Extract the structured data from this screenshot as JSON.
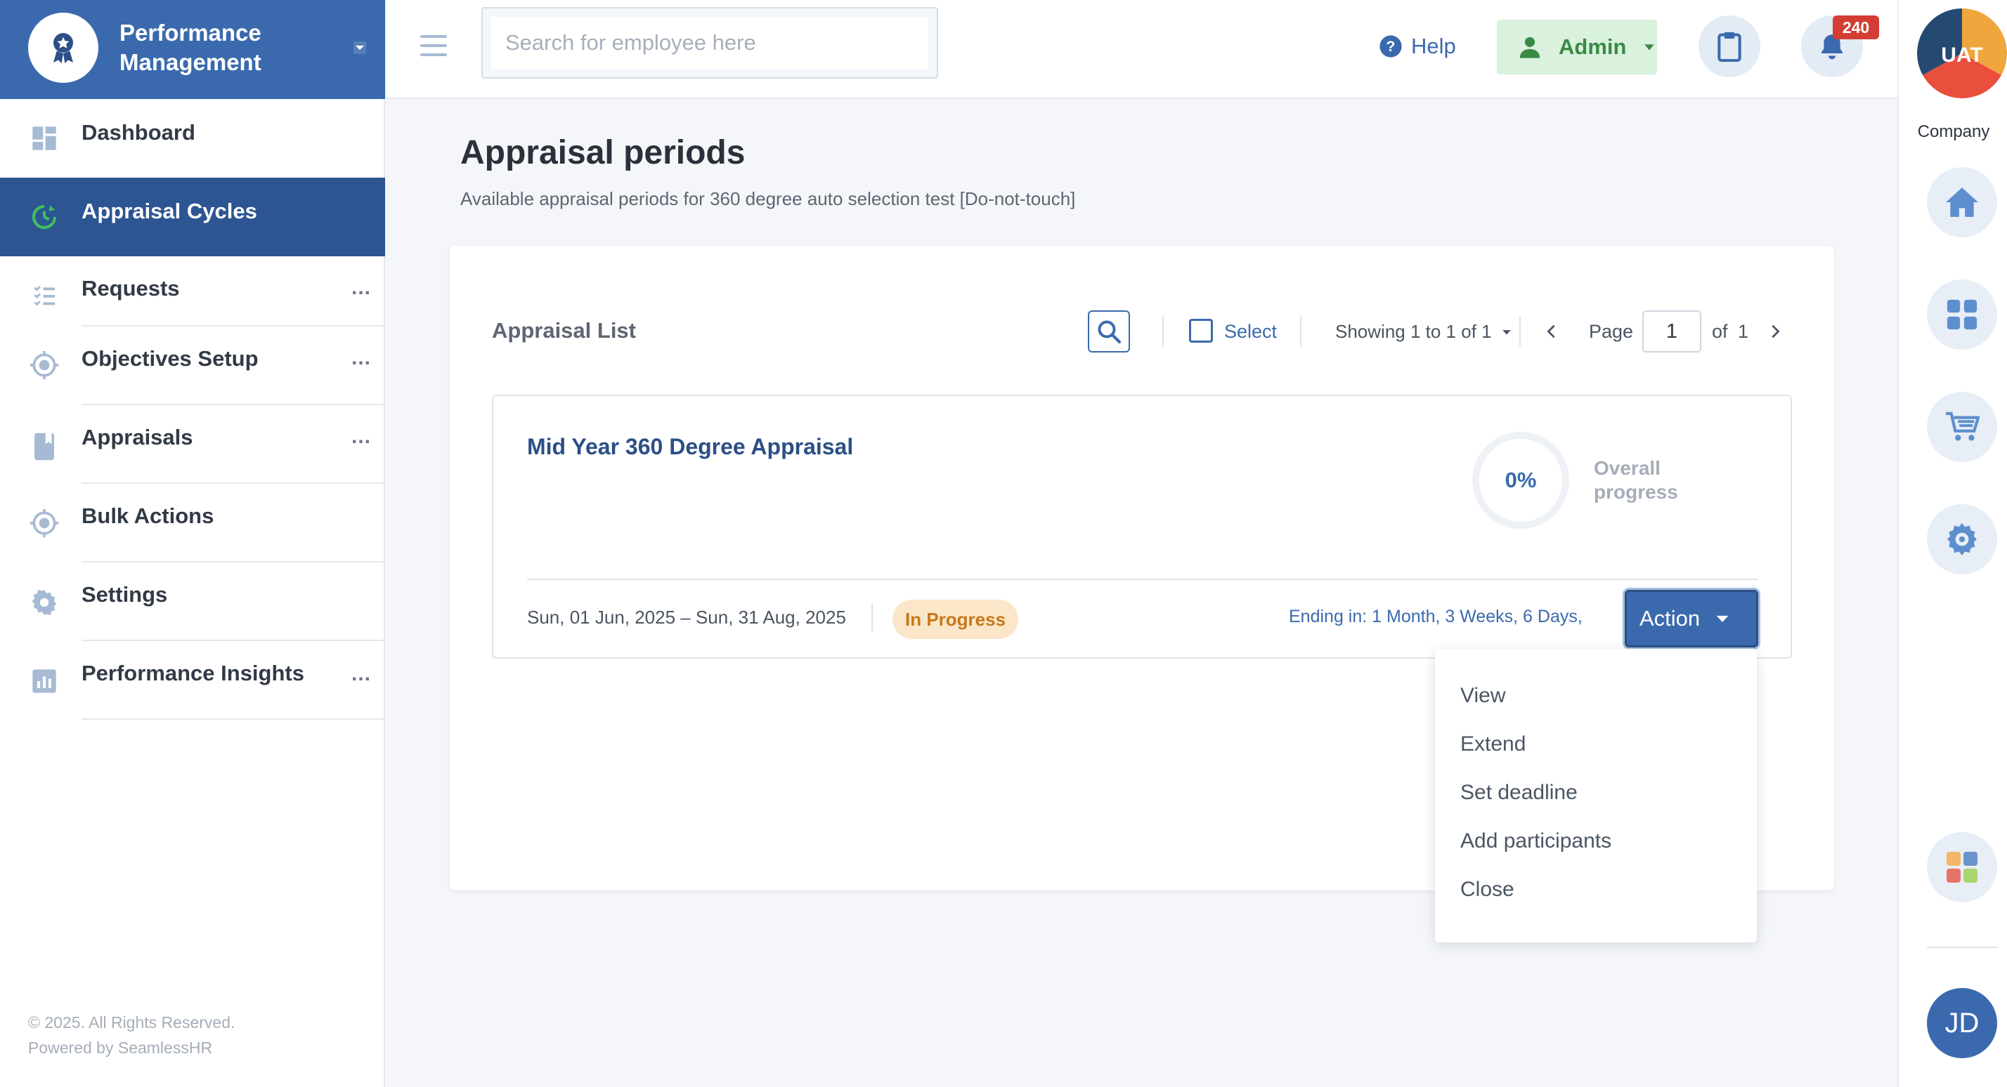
{
  "sidebar": {
    "brand_title": "Performance Management",
    "items": [
      {
        "label": "Dashboard",
        "icon": "dashboard-icon",
        "more": ""
      },
      {
        "label": "Appraisal Cycles",
        "icon": "cycle-icon",
        "more": ""
      },
      {
        "label": "Requests",
        "icon": "checklist-icon",
        "more": "..."
      },
      {
        "label": "Objectives Setup",
        "icon": "target-icon",
        "more": "..."
      },
      {
        "label": "Appraisals",
        "icon": "book-icon",
        "more": "..."
      },
      {
        "label": "Bulk Actions",
        "icon": "target-icon",
        "more": ""
      },
      {
        "label": "Settings",
        "icon": "gear-icon",
        "more": ""
      },
      {
        "label": "Performance Insights",
        "icon": "chart-icon",
        "more": "..."
      }
    ],
    "active_item": "Appraisal Cycles",
    "footer_copyright": "© 2025. All Rights Reserved.",
    "footer_powered": "Powered by SeamlessHR"
  },
  "topbar": {
    "search_placeholder": "Search for employee here",
    "help_label": "Help",
    "admin_label": "Admin",
    "notification_count": "240"
  },
  "right_rail": {
    "company_label": "Company",
    "company_logo_text": "UAT",
    "user_initials": "JD"
  },
  "main": {
    "title": "Appraisal periods",
    "subtitle": "Available appraisal periods for 360 degree auto selection test [Do-not-touch]",
    "list": {
      "title": "Appraisal List",
      "select_label": "Select",
      "showing": "Showing 1 to 1 of 1",
      "page_label": "Page",
      "page_value": "1",
      "of_label": "of",
      "page_total": "1"
    },
    "appraisal": {
      "title": "Mid Year 360 Degree Appraisal",
      "progress": "0%",
      "progress_fraction": 0,
      "progress_label": "Overall progress",
      "dates": "Sun, 01 Jun, 2025 – Sun, 31 Aug, 2025",
      "status": "In Progress",
      "ending": "Ending in: 1 Month, 3 Weeks, 6 Days,",
      "action_label": "Action",
      "action_menu": [
        "View",
        "Extend",
        "Set deadline",
        "Add participants",
        "Close"
      ]
    }
  },
  "colors": {
    "primary": "#3a6aad",
    "sidebar_active": "#2c5592",
    "admin_bg": "#d9f1dd",
    "admin_text": "#3a8a46",
    "badge": "#d43d34",
    "status_bg": "#fbe6c9",
    "status_text": "#c7781a"
  }
}
